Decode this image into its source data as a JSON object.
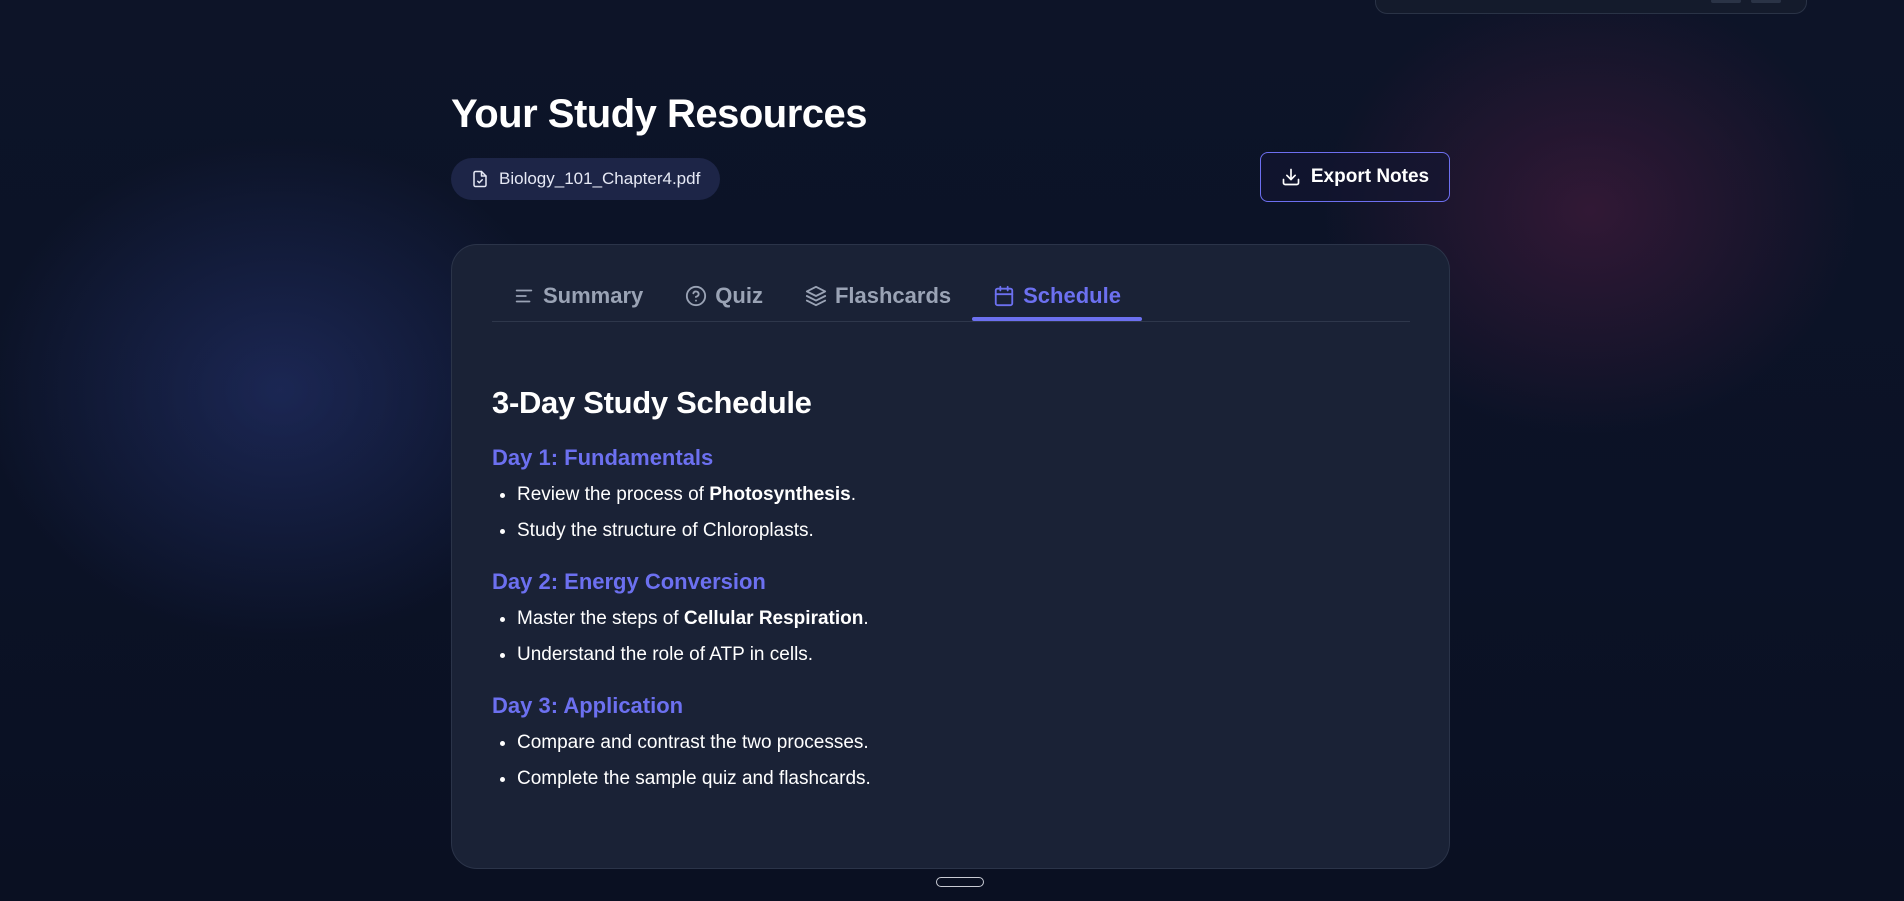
{
  "page": {
    "title": "Your Study Resources"
  },
  "file_chip": {
    "icon": "file-check-icon",
    "filename": "Biology_101_Chapter4.pdf"
  },
  "toolbar": {
    "export_label": "Export Notes",
    "export_icon": "download-icon"
  },
  "tabs": [
    {
      "label": "Summary",
      "icon": "align-left-icon",
      "active": false
    },
    {
      "label": "Quiz",
      "icon": "help-circle-icon",
      "active": false
    },
    {
      "label": "Flashcards",
      "icon": "layers-icon",
      "active": false
    },
    {
      "label": "Schedule",
      "icon": "calendar-icon",
      "active": true
    }
  ],
  "schedule": {
    "title": "3-Day Study Schedule",
    "days": [
      {
        "heading": "Day 1: Fundamentals",
        "items": [
          {
            "before": "Review the process of ",
            "bold": "Photosynthesis",
            "after": "."
          },
          {
            "before": "Study the structure of Chloroplasts.",
            "bold": "",
            "after": ""
          }
        ]
      },
      {
        "heading": "Day 2: Energy Conversion",
        "items": [
          {
            "before": "Master the steps of ",
            "bold": "Cellular Respiration",
            "after": "."
          },
          {
            "before": "Understand the role of ATP in cells.",
            "bold": "",
            "after": ""
          }
        ]
      },
      {
        "heading": "Day 3: Application",
        "items": [
          {
            "before": "Compare and contrast the two processes.",
            "bold": "",
            "after": ""
          },
          {
            "before": "Complete the sample quiz and flashcards.",
            "bold": "",
            "after": ""
          }
        ]
      }
    ]
  },
  "colors": {
    "accent": "#6c70f0",
    "card_bg": "#1a2236",
    "page_bg": "#0d1428",
    "muted_text": "#9aa3b5"
  }
}
